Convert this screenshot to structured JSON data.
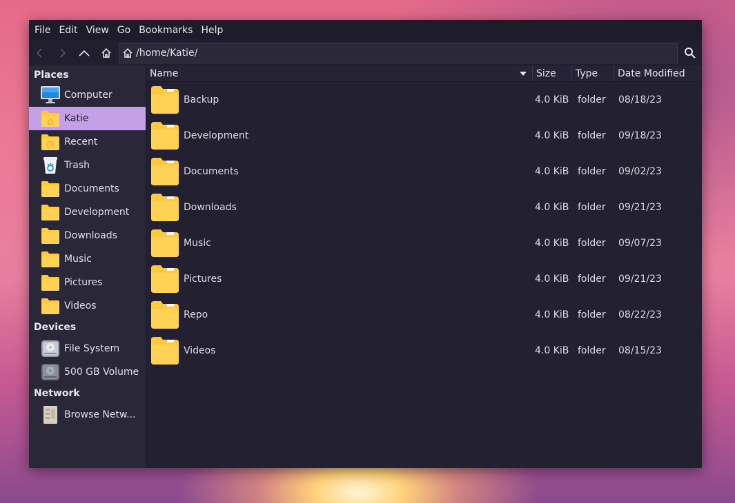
{
  "menu": [
    "File",
    "Edit",
    "View",
    "Go",
    "Bookmarks",
    "Help"
  ],
  "address": {
    "path": "/home/Katie/"
  },
  "sidebar": {
    "places_heading": "Places",
    "places": [
      {
        "label": "Computer",
        "icon": "computer-icon"
      },
      {
        "label": "Katie",
        "icon": "home-folder-icon",
        "selected": true
      },
      {
        "label": "Recent",
        "icon": "recent-folder-icon"
      },
      {
        "label": "Trash",
        "icon": "trash-icon"
      },
      {
        "label": "Documents",
        "icon": "folder-icon"
      },
      {
        "label": "Development",
        "icon": "folder-icon"
      },
      {
        "label": "Downloads",
        "icon": "folder-icon"
      },
      {
        "label": "Music",
        "icon": "folder-icon"
      },
      {
        "label": "Pictures",
        "icon": "folder-icon"
      },
      {
        "label": "Videos",
        "icon": "folder-icon"
      }
    ],
    "devices_heading": "Devices",
    "devices": [
      {
        "label": "File System",
        "icon": "drive-icon"
      },
      {
        "label": "500 GB Volume",
        "icon": "drive-icon"
      }
    ],
    "network_heading": "Network",
    "network": [
      {
        "label": "Browse Netw...",
        "icon": "network-icon"
      }
    ]
  },
  "columns": {
    "name": "Name",
    "size": "Size",
    "type": "Type",
    "date": "Date Modified"
  },
  "files": [
    {
      "name": "Backup",
      "size": "4.0 KiB",
      "type": "folder",
      "date": "08/18/23"
    },
    {
      "name": "Development",
      "size": "4.0 KiB",
      "type": "folder",
      "date": "09/18/23"
    },
    {
      "name": "Documents",
      "size": "4.0 KiB",
      "type": "folder",
      "date": "09/02/23"
    },
    {
      "name": "Downloads",
      "size": "4.0 KiB",
      "type": "folder",
      "date": "09/21/23"
    },
    {
      "name": "Music",
      "size": "4.0 KiB",
      "type": "folder",
      "date": "09/07/23"
    },
    {
      "name": "Pictures",
      "size": "4.0 KiB",
      "type": "folder",
      "date": "09/21/23"
    },
    {
      "name": "Repo",
      "size": "4.0 KiB",
      "type": "folder",
      "date": "08/22/23"
    },
    {
      "name": "Videos",
      "size": "4.0 KiB",
      "type": "folder",
      "date": "08/15/23"
    }
  ],
  "colors": {
    "accent": "#c4a0e6",
    "folder": "#ffc83d",
    "window_bg": "#272436"
  }
}
